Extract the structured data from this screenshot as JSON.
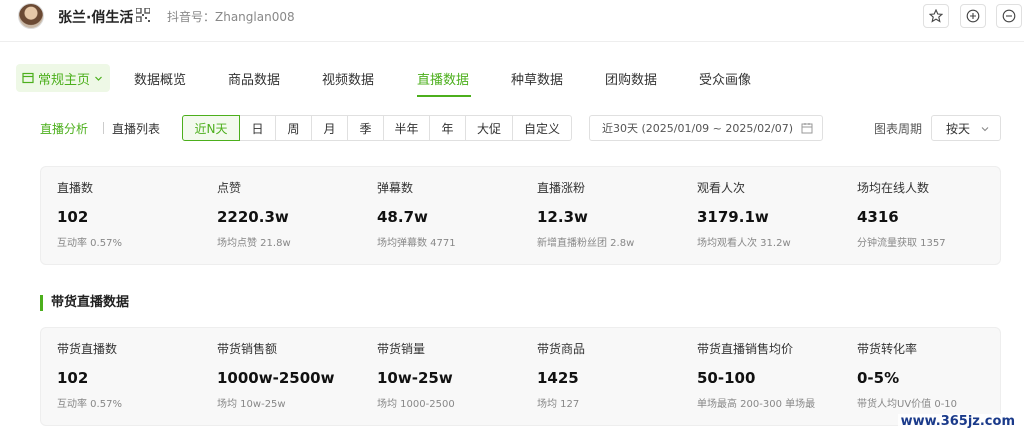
{
  "header": {
    "user_name": "张兰·俏生活",
    "douyin_id": "抖音号：Zhanglan008"
  },
  "nav": {
    "home_label": "常规主页",
    "tabs": [
      "数据概览",
      "商品数据",
      "视频数据",
      "直播数据",
      "种草数据",
      "团购数据",
      "受众画像"
    ],
    "active_tab": "直播数据"
  },
  "filters": {
    "sub_tabs": [
      "直播分析",
      "直播列表"
    ],
    "periods": [
      "近N天",
      "日",
      "周",
      "月",
      "季",
      "半年",
      "年",
      "大促",
      "自定义"
    ],
    "active_period": "近N天",
    "date_range": "近30天 (2025/01/09 ~ 2025/02/07)",
    "chart_period_label": "图表周期",
    "chart_period_value": "按天"
  },
  "live_stats": [
    {
      "label": "直播数",
      "value": "102",
      "sub": "互动率 0.57%"
    },
    {
      "label": "点赞",
      "value": "2220.3w",
      "sub": "场均点赞 21.8w"
    },
    {
      "label": "弹幕数",
      "value": "48.7w",
      "sub": "场均弹幕数 4771"
    },
    {
      "label": "直播涨粉",
      "value": "12.3w",
      "sub": "新增直播粉丝团 2.8w"
    },
    {
      "label": "观看人次",
      "value": "3179.1w",
      "sub": "场均观看人次 31.2w"
    },
    {
      "label": "场均在线人数",
      "value": "4316",
      "sub": "分钟流量获取 1357"
    }
  ],
  "section_title": "带货直播数据",
  "goods_stats": [
    {
      "label": "带货直播数",
      "value": "102",
      "sub": "互动率 0.57%"
    },
    {
      "label": "带货销售额",
      "value": "1000w-2500w",
      "sub": "场均 10w-25w"
    },
    {
      "label": "带货销量",
      "value": "10w-25w",
      "sub": "场均 1000-2500"
    },
    {
      "label": "带货商品",
      "value": "1425",
      "sub": "场均 127"
    },
    {
      "label": "带货直播销售均价",
      "value": "50-100",
      "sub": "单场最高 200-300 单场最"
    },
    {
      "label": "带货转化率",
      "value": "0-5%",
      "sub": "带货人均UV价值 0-10"
    }
  ],
  "watermark": "www.365jz.com",
  "colors": {
    "accent": "#4caf1c",
    "card_bg": "#f8f8f8"
  }
}
